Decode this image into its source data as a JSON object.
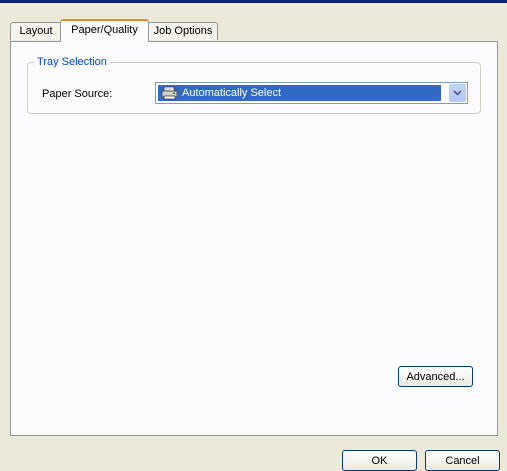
{
  "tabs": [
    {
      "label": "Layout",
      "active": false
    },
    {
      "label": "Paper/Quality",
      "active": true
    },
    {
      "label": "Job Options",
      "active": false
    }
  ],
  "tray_selection": {
    "group_title": "Tray Selection",
    "paper_source_label": "Paper Source:",
    "paper_source_value": "Automatically Select",
    "paper_source_icon": "printer-tray-icon"
  },
  "buttons": {
    "advanced": "Advanced...",
    "ok": "OK",
    "cancel": "Cancel"
  },
  "colors": {
    "selection": "#316ac5",
    "group_title": "#0046d5",
    "active_tab_accent": "#e68b2c",
    "dialog_background": "#ece9d8"
  }
}
